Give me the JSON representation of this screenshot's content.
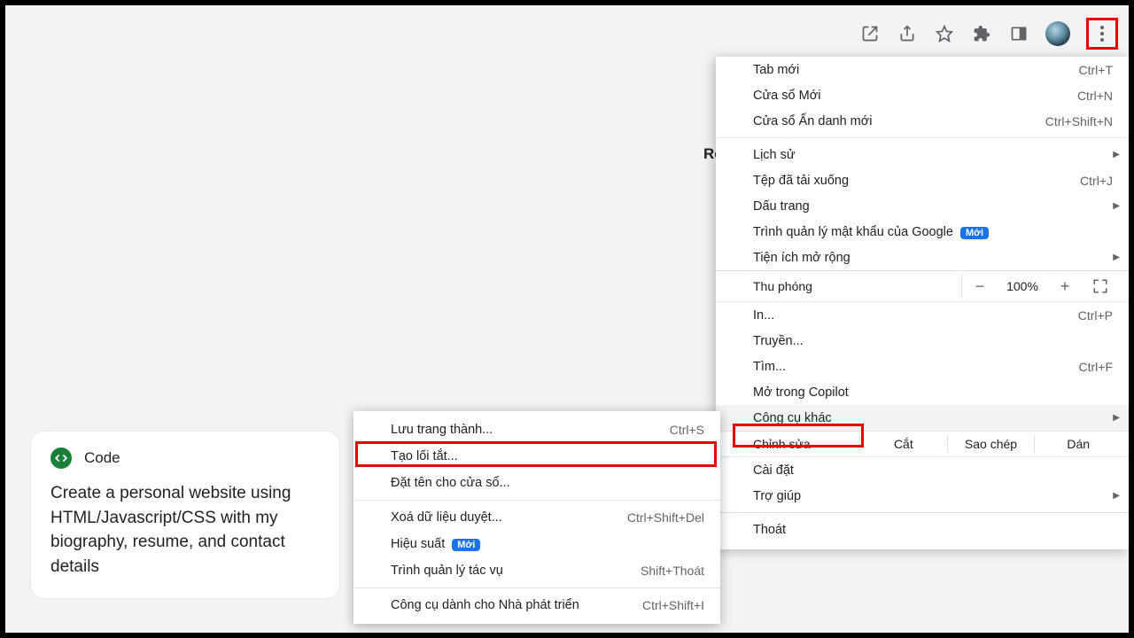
{
  "toolbar": {
    "icons": [
      "open-in-new",
      "share",
      "star",
      "extensions",
      "side-panel"
    ]
  },
  "partial_label": "Re",
  "card": {
    "title": "Code",
    "description": "Create a personal website using HTML/Javascript/CSS with my biography, resume, and contact details"
  },
  "menu": {
    "new_tab": "Tab mới",
    "new_tab_sc": "Ctrl+T",
    "new_window": "Cửa sổ Mới",
    "new_window_sc": "Ctrl+N",
    "incognito": "Cửa sổ Ẩn danh mới",
    "incognito_sc": "Ctrl+Shift+N",
    "history": "Lịch sử",
    "downloads": "Tệp đã tải xuống",
    "downloads_sc": "Ctrl+J",
    "bookmarks": "Dấu trang",
    "pwmgr": "Trình quản lý mật khẩu của Google",
    "new_badge": "Mới",
    "extensions": "Tiện ích mở rộng",
    "zoom": "Thu phóng",
    "zoom_val": "100%",
    "print": "In...",
    "print_sc": "Ctrl+P",
    "cast": "Truyền...",
    "find": "Tìm...",
    "find_sc": "Ctrl+F",
    "copilot": "Mở trong Copilot",
    "more_tools": "Công cụ khác",
    "edit": "Chỉnh sửa",
    "cut": "Cắt",
    "copy": "Sao chép",
    "paste": "Dán",
    "settings": "Cài đặt",
    "help": "Trợ giúp",
    "exit": "Thoát"
  },
  "submenu": {
    "save_page": "Lưu trang thành...",
    "save_page_sc": "Ctrl+S",
    "shortcut": "Tạo lối tắt...",
    "name_window": "Đặt tên cho cửa sổ...",
    "clear_data": "Xoá dữ liệu duyệt...",
    "clear_data_sc": "Ctrl+Shift+Del",
    "performance": "Hiệu suất",
    "task_manager": "Trình quản lý tác vụ",
    "task_manager_sc": "Shift+Thoát",
    "dev_tools": "Công cụ dành cho Nhà phát triển",
    "dev_tools_sc": "Ctrl+Shift+I"
  }
}
